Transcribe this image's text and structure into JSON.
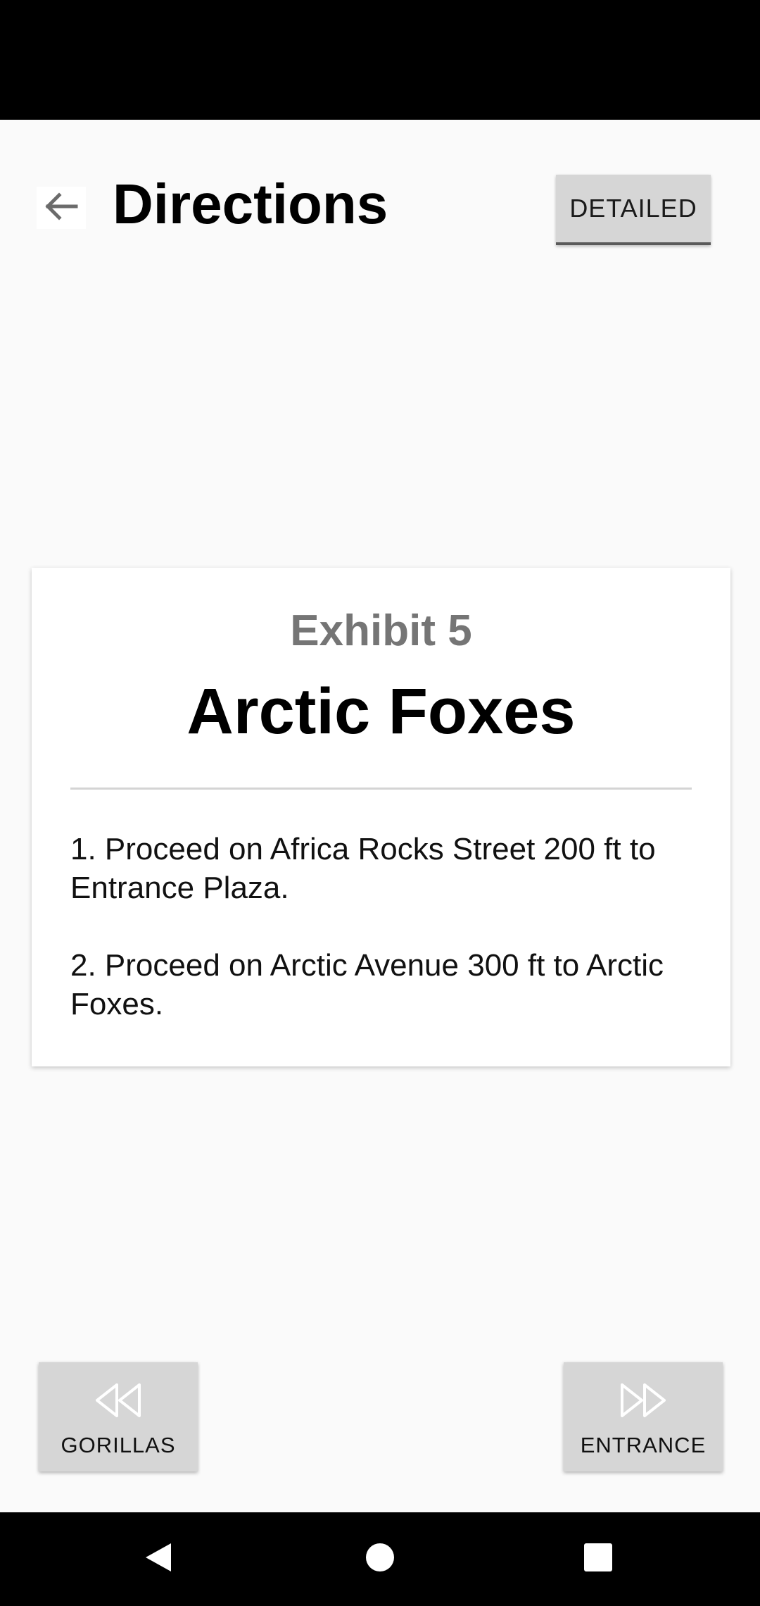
{
  "header": {
    "title": "Directions",
    "detailed_label": "DETAILED"
  },
  "card": {
    "exhibit_number": "Exhibit 5",
    "exhibit_name": "Arctic Foxes",
    "steps": [
      "1. Proceed on Africa Rocks Street 200 ft to Entrance Plaza.",
      "2. Proceed on Arctic Avenue 300 ft to Arctic Foxes."
    ]
  },
  "navigation": {
    "previous_label": "GORILLAS",
    "next_label": "ENTRANCE"
  },
  "icons": {
    "back": "arrow-left-icon",
    "previous": "rewind-icon",
    "next": "fast-forward-icon",
    "system_back": "triangle-back-icon",
    "system_home": "circle-home-icon",
    "system_recents": "square-recents-icon"
  },
  "colors": {
    "background": "#fafafa",
    "button": "#d6d6d6",
    "exhibit_number": "#757575",
    "bars": "#000000"
  }
}
